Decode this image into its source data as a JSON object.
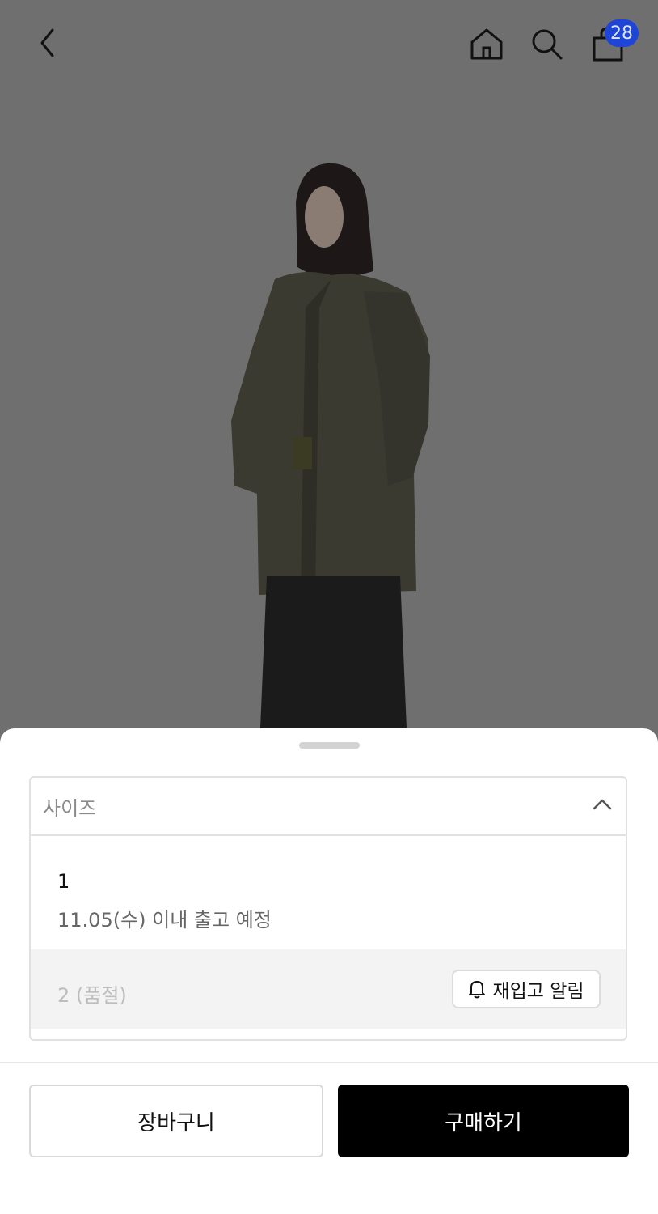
{
  "header": {
    "icons": {
      "back": "chevron-left-icon",
      "home": "home-icon",
      "search": "search-icon",
      "cart": "shopping-bag-icon"
    },
    "cart_badge": "28",
    "colors": {
      "badge_bg": "#1f45d6",
      "overlay": "#6f6f6f"
    }
  },
  "sheet": {
    "size_selector_label": "사이즈",
    "options": [
      {
        "size": "1",
        "shipping_note": "11.05(수) 이내 출고 예정"
      },
      {
        "size": "2 (품절)",
        "restock_label": "재입고 알림"
      }
    ],
    "buttons": {
      "cart_label": "장바구니",
      "buy_label": "구매하기"
    }
  }
}
